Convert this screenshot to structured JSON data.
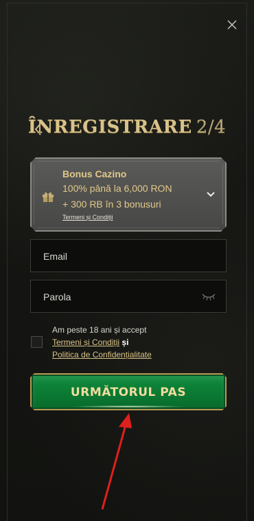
{
  "header": {
    "title": "ÎNREGISTRARE",
    "step": "2/4"
  },
  "bonus": {
    "title": "Bonus Cazino",
    "line1": "100% până la 6,000 RON",
    "line2": "+ 300 RB în 3 bonusuri",
    "terms_link": "Termeni și Condiții",
    "icon": "gift-icon"
  },
  "form": {
    "email_placeholder": "Email",
    "password_placeholder": "Parola"
  },
  "consent": {
    "text": "Am peste 18 ani și accept",
    "terms_link": "Termeni și Condiții",
    "and": "și",
    "privacy_link": "Politica de Confidențialitate"
  },
  "actions": {
    "next_label": "URMĂTORUL PAS"
  },
  "colors": {
    "accent_gold": "#d8c28b",
    "button_green": "#0f8b3d",
    "annotation_arrow": "#e0201c"
  }
}
